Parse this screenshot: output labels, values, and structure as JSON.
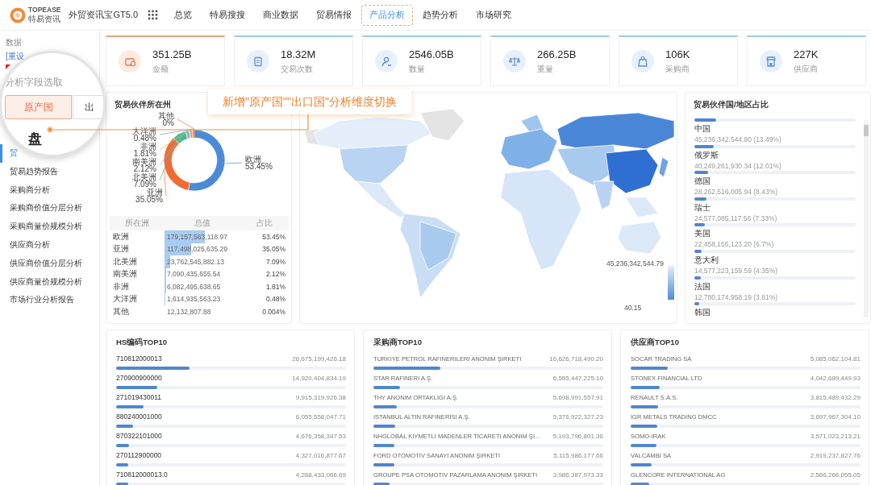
{
  "header": {
    "brand": "TOPEASE",
    "brand_sub": "特易资讯",
    "app_title": "外贸资讯宝GT5.0",
    "nav": [
      {
        "label": "总览",
        "selected": false
      },
      {
        "label": "特易搜搜",
        "selected": false
      },
      {
        "label": "商业数据",
        "selected": false
      },
      {
        "label": "贸易情报",
        "selected": false
      },
      {
        "label": "产品分析",
        "selected": true
      },
      {
        "label": "趋势分析",
        "selected": false
      },
      {
        "label": "市场研究",
        "selected": false
      }
    ]
  },
  "sidebar": {
    "section_label": "数据",
    "reset_link": "[重设",
    "items": [
      {
        "label": "贸",
        "selected": true
      },
      {
        "label": "贸易趋势报告",
        "selected": false
      },
      {
        "label": "采购商分析",
        "selected": false
      },
      {
        "label": "采购商价值分层分析",
        "selected": false
      },
      {
        "label": "采购商量价规模分析",
        "selected": false
      },
      {
        "label": "供应商分析",
        "selected": false
      },
      {
        "label": "供应商价值分层分析",
        "selected": false
      },
      {
        "label": "供应商量价规模分析",
        "selected": false
      },
      {
        "label": "市场行业分析报告",
        "selected": false
      }
    ]
  },
  "field_picker": {
    "title": "分析字段选取",
    "options": [
      {
        "label": "原产国",
        "selected": true
      },
      {
        "label": "出",
        "selected": false
      }
    ],
    "heading": "盘"
  },
  "callout": "新增\"原产国\"\"出口国\"分析维度切换",
  "stats": [
    {
      "kind": "amount",
      "value": "351.25B",
      "label": "金额",
      "selected": true
    },
    {
      "kind": "count",
      "value": "18.32M",
      "label": "交易次数",
      "selected": false
    },
    {
      "kind": "quantity",
      "value": "2546.05B",
      "label": "数量",
      "selected": false
    },
    {
      "kind": "weight",
      "value": "266.25B",
      "label": "重量",
      "selected": false
    },
    {
      "kind": "buyer",
      "value": "106K",
      "label": "采购商",
      "selected": false
    },
    {
      "kind": "supplier",
      "value": "227K",
      "label": "供应商",
      "selected": false
    }
  ],
  "continent_panel": {
    "title": "贸易伙伴所在州",
    "chart_data": {
      "type": "donut",
      "categories": [
        "欧洲",
        "亚洲",
        "北美洲",
        "南美洲",
        "非洲",
        "大洋洲",
        "其他"
      ],
      "values": [
        53.45,
        35.05,
        7.09,
        2.12,
        1.81,
        0.48,
        0.004
      ],
      "value_labels": [
        "53.45%",
        "35.05%",
        "7.09%",
        "2.12%",
        "1.81%",
        "0.48%",
        "0%"
      ]
    },
    "table": {
      "columns": [
        "所在洲",
        "总值",
        "占比"
      ],
      "rows": [
        {
          "name": "欧洲",
          "total": "179,157,563,118.97",
          "share": "53.45%",
          "level": 0.5345
        },
        {
          "name": "亚洲",
          "total": "117,498,025,635.29",
          "share": "35.05%",
          "level": 0.3505
        },
        {
          "name": "北美洲",
          "total": "23,762,545,882.13",
          "share": "7.09%",
          "level": 0.0709
        },
        {
          "name": "南美洲",
          "total": "7,090,435,655.54",
          "share": "2.12%",
          "level": 0.0212
        },
        {
          "name": "非洲",
          "total": "6,082,495,638.65",
          "share": "1.81%",
          "level": 0.0181
        },
        {
          "name": "大洋洲",
          "total": "1,614,935,563.23",
          "share": "0.48%",
          "level": 0.0048
        },
        {
          "name": "其他",
          "total": "12,132,807.88",
          "share": "0.004%"
        }
      ]
    }
  },
  "map": {
    "legend_max": "45,236,342,544.79",
    "legend_min": "40.15"
  },
  "partner_panel": {
    "title": "贸易伙伴国/地区占比",
    "items": [
      {
        "name": "中国",
        "value": "45,236,342,544.80 (13.49%)",
        "level": 0.1349
      },
      {
        "name": "俄罗斯",
        "value": "40,249,261,930.34 (12.01%)",
        "level": 0.1201
      },
      {
        "name": "德国",
        "value": "28,262,516,005.94 (8.43%)",
        "level": 0.0843
      },
      {
        "name": "瑞士",
        "value": "24,577,085,117.56 (7.33%)",
        "level": 0.0733
      },
      {
        "name": "美国",
        "value": "22,458,155,123.20 (6.7%)",
        "level": 0.067
      },
      {
        "name": "意大利",
        "value": "14,577,223,159.59 (4.35%)",
        "level": 0.0435
      },
      {
        "name": "法国",
        "value": "12,780,174,958.19 (3.81%)",
        "level": 0.0381
      },
      {
        "name": "韩国",
        "level": 0.03
      }
    ]
  },
  "top_lists": [
    {
      "title": "HS编码TOP10",
      "rows": [
        {
          "name": "710812000013",
          "value": "26,675,199,426.18",
          "level": 0.32
        },
        {
          "name": "270900900000",
          "value": "14,920,404,834.19",
          "level": 0.18
        },
        {
          "name": "271019430011",
          "value": "9,915,319,926.38",
          "level": 0.12
        },
        {
          "name": "880240001000",
          "value": "6,055,558,047.71",
          "level": 0.073
        },
        {
          "name": "870322101000",
          "value": "4,676,358,347.53",
          "level": 0.056
        },
        {
          "name": "270112900000",
          "value": "4,327,016,877.67",
          "level": 0.052
        },
        {
          "name": "710812000013.0",
          "value": "4,288,433,066.69",
          "level": 0.051
        }
      ]
    },
    {
      "title": "采购商TOP10",
      "rows": [
        {
          "name": "TURKIYE PETROL RAFINERILERI ANONIM ŞIRKETI",
          "value": "16,626,718,490.20",
          "level": 0.29
        },
        {
          "name": "STAR RAFINERI A.Ş.",
          "value": "6,555,447,225.10",
          "level": 0.115
        },
        {
          "name": "THY ANONIM ORTAKLIGI A.Ş.",
          "value": "5,698,991,557.91",
          "level": 0.1
        },
        {
          "name": "ISTANBUL ALTIN RAFINERISI A.Ş.",
          "value": "5,376,922,327.23",
          "level": 0.094
        },
        {
          "name": "NHGLOBAL KIYMETLI MADENLER TICARETI ANONIM ŞI...",
          "value": "5,193,796,801.36",
          "level": 0.091
        },
        {
          "name": "FORD OTOMOTIV SANAYI ANONIM ŞIRKETI",
          "value": "5,115,986,177.66",
          "level": 0.09
        },
        {
          "name": "GROUPE PSA OTOMOTIV PAZARLAMA ANONIM ŞIRKETI",
          "value": "3,986,387,973.33",
          "level": 0.07
        }
      ]
    },
    {
      "title": "供应商TOP10",
      "rows": [
        {
          "name": "SOCAR TRADING SA",
          "value": "5,085,062,104.81",
          "level": 0.16
        },
        {
          "name": "STONEX FINANCIAL LTD",
          "value": "4,042,689,449.93",
          "level": 0.126
        },
        {
          "name": "RENAULT S.A.S.",
          "value": "3,815,489,432.29",
          "level": 0.119
        },
        {
          "name": "IGR METALS TRADING DMCC",
          "value": "3,697,967,304.10",
          "level": 0.116
        },
        {
          "name": "SOMO-IRAK",
          "value": "3,571,023,213.21",
          "level": 0.112
        },
        {
          "name": "VALCAMBI SA",
          "value": "2,919,237,827.76",
          "level": 0.091
        },
        {
          "name": "GLENCORE INTERNATIONAL AG",
          "value": "2,566,266,055.05",
          "level": 0.08
        }
      ]
    }
  ]
}
